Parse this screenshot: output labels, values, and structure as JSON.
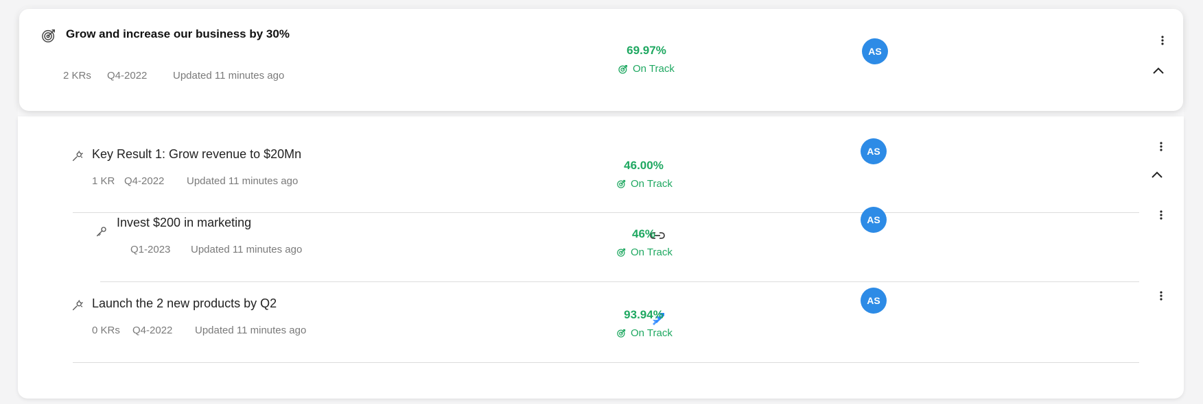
{
  "objective": {
    "title": "Grow and increase our business by 30%",
    "krs": "2 KRs",
    "period": "Q4-2022",
    "updated": "Updated 11 minutes ago",
    "progress": "69.97%",
    "status": "On Track",
    "owner_initials": "AS",
    "icon": "target-icon",
    "expanded": true
  },
  "key_results": [
    {
      "title": "Key Result 1: Grow revenue to $20Mn",
      "krs": "1 KR",
      "period": "Q4-2022",
      "updated": "Updated 11 minutes ago",
      "progress": "46.00%",
      "status": "On Track",
      "owner_initials": "AS",
      "icon": "key-result-icon",
      "expanded": true,
      "children": [
        {
          "title": "Invest $200 in marketing",
          "period": "Q1-2023",
          "updated": "Updated 11 minutes ago",
          "progress": "46%",
          "status": "On Track",
          "owner_initials": "AS",
          "icon": "key-icon",
          "integration_icon": "link-icon"
        }
      ]
    },
    {
      "title": "Launch the 2 new products by Q2",
      "krs": "0 KRs",
      "period": "Q4-2022",
      "updated": "Updated 11 minutes ago",
      "progress": "93.94%",
      "status": "On Track",
      "owner_initials": "AS",
      "icon": "key-result-icon",
      "integration_icon": "jira-icon"
    }
  ],
  "colors": {
    "on_track": "#1fa861",
    "avatar": "#2d8be6",
    "jira": "#2684ff"
  }
}
